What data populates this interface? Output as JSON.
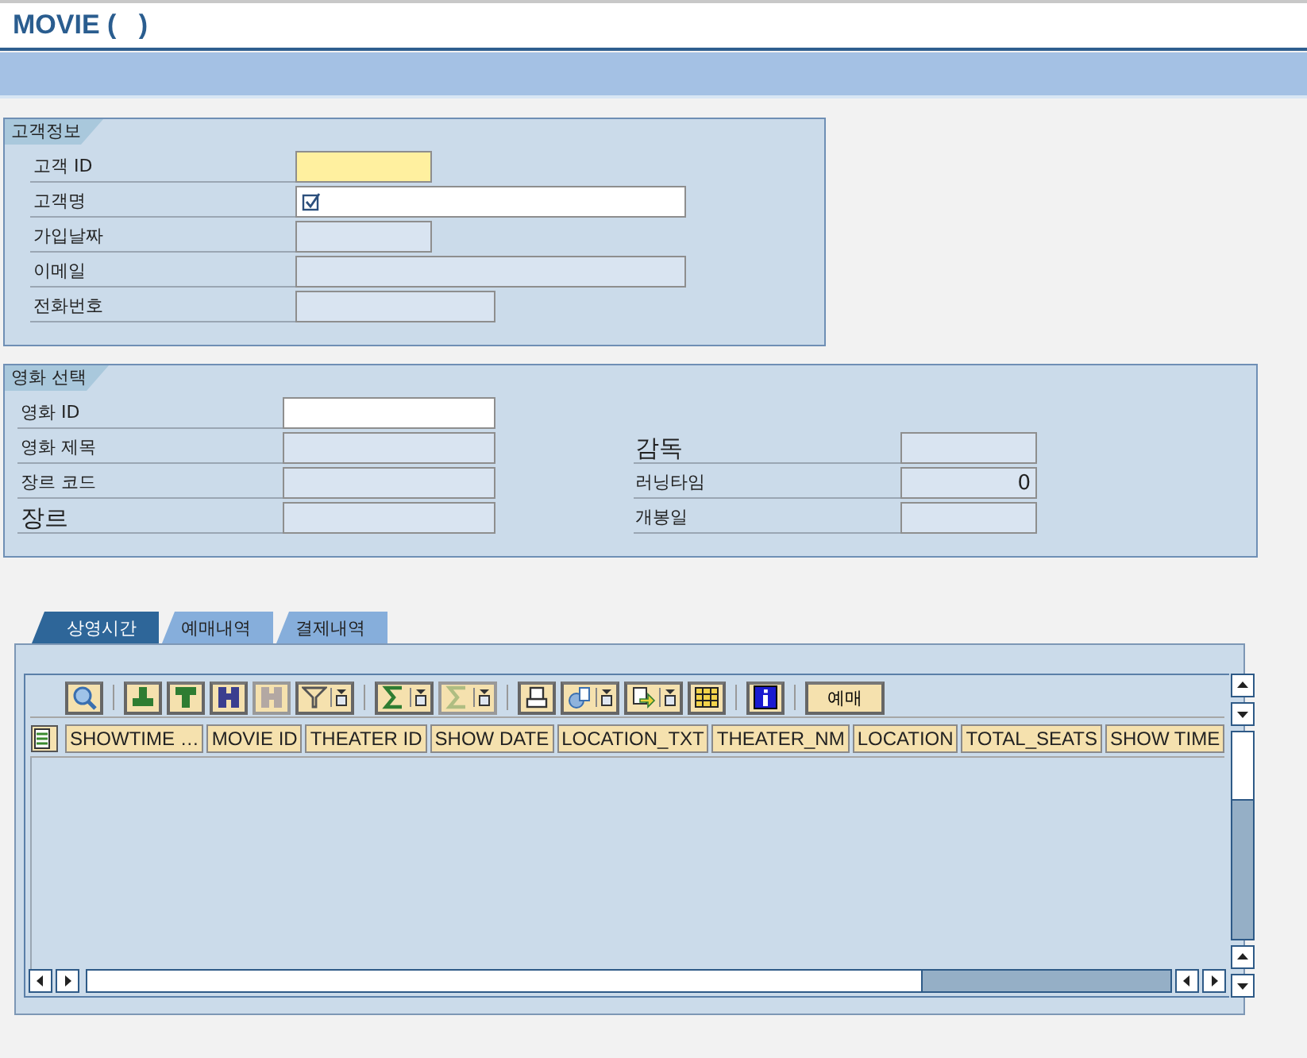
{
  "window": {
    "title": "MOVIE (   )"
  },
  "customer_group": {
    "title": "고객정보",
    "fields": [
      {
        "label": "고객 ID",
        "kind": "required",
        "check_icon": false
      },
      {
        "label": "고객명",
        "kind": "editable",
        "check_icon": true
      },
      {
        "label": "가입날짜",
        "kind": "readonly",
        "check_icon": false
      },
      {
        "label": "이메일",
        "kind": "readonly",
        "check_icon": false
      },
      {
        "label": "전화번호",
        "kind": "readonly",
        "check_icon": false
      }
    ]
  },
  "movie_group": {
    "title": "영화 선택",
    "left_fields": [
      {
        "label": "영화 ID",
        "kind": "editable",
        "large": false
      },
      {
        "label": "영화 제목",
        "kind": "readonly",
        "large": false
      },
      {
        "label": "장르 코드",
        "kind": "readonly",
        "large": false
      },
      {
        "label": "장르",
        "kind": "readonly",
        "large": true
      }
    ],
    "right_fields": [
      {
        "label": "감독",
        "kind": "readonly",
        "large": true
      },
      {
        "label": "러닝타임",
        "kind": "readonly",
        "large": false,
        "value": "0"
      },
      {
        "label": "개봉일",
        "kind": "readonly",
        "large": false
      }
    ]
  },
  "tabs": [
    {
      "label": "상영시간",
      "selected": true
    },
    {
      "label": "예매내역",
      "selected": false
    },
    {
      "label": "결제내역",
      "selected": false
    }
  ],
  "toolbar": [
    [
      {
        "kind": "details",
        "disabled": false,
        "menu": false
      }
    ],
    [
      {
        "kind": "sort-asc",
        "disabled": false,
        "menu": false
      },
      {
        "kind": "sort-desc",
        "disabled": false,
        "menu": false
      },
      {
        "kind": "find",
        "disabled": false,
        "menu": false
      },
      {
        "kind": "find-next",
        "disabled": true,
        "menu": false
      },
      {
        "kind": "filter",
        "disabled": false,
        "menu": true
      }
    ],
    [
      {
        "kind": "sum",
        "disabled": false,
        "menu": true
      },
      {
        "kind": "subtotal",
        "disabled": true,
        "menu": true
      }
    ],
    [
      {
        "kind": "print",
        "disabled": false,
        "menu": false
      },
      {
        "kind": "views",
        "disabled": false,
        "menu": true
      },
      {
        "kind": "export",
        "disabled": false,
        "menu": true
      },
      {
        "kind": "layout",
        "disabled": false,
        "menu": false
      }
    ],
    [
      {
        "kind": "info",
        "disabled": false,
        "menu": false
      }
    ],
    [
      {
        "kind": "text",
        "label": "예매",
        "disabled": false,
        "menu": false
      }
    ]
  ],
  "table": {
    "columns": [
      "SHOWTIME …",
      "MOVIE ID",
      "THEATER ID",
      "SHOW DATE",
      "LOCATION_TXT",
      "THEATER_NM",
      "LOCATION",
      "TOTAL_SEATS",
      "SHOW TIME"
    ]
  }
}
